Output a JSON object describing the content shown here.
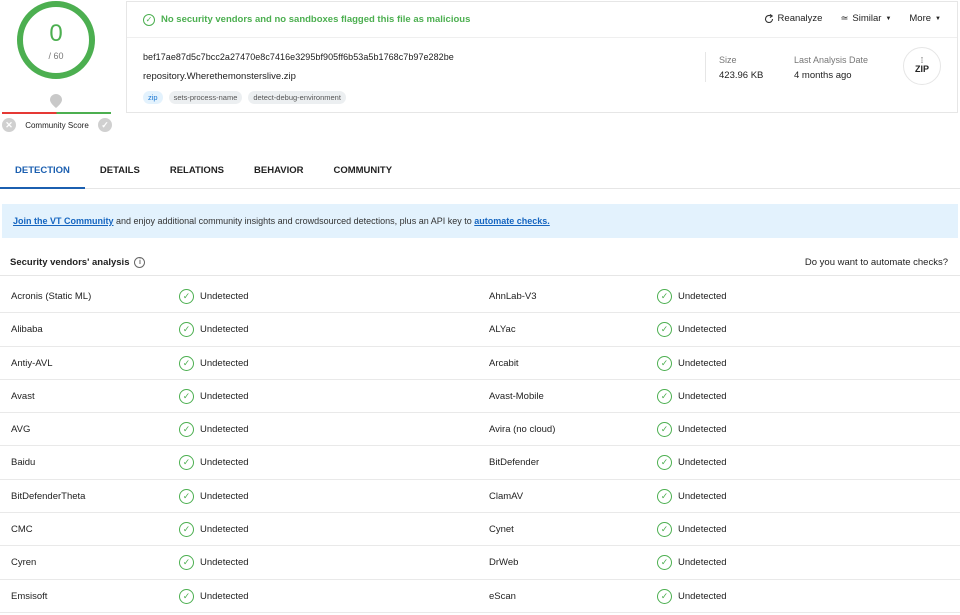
{
  "score": {
    "value": "0",
    "total": "/ 60",
    "community_label": "Community Score"
  },
  "summary": {
    "status": "No security vendors and no sandboxes flagged this file as malicious",
    "actions": {
      "reanalyze": "Reanalyze",
      "similar": "Similar",
      "more": "More"
    },
    "hash": "bef17ae87d5c7bcc2a27470e8c7416e3295bf905ff6b53a5b1768c7b97e282be",
    "filename": "repository.Wherethemonsterslive.zip",
    "tags": [
      "zip",
      "sets-process-name",
      "detect-debug-environment"
    ],
    "size_label": "Size",
    "size_value": "423.96 KB",
    "last_analysis_label": "Last Analysis Date",
    "last_analysis_value": "4 months ago",
    "file_type": "ZIP"
  },
  "tabs": [
    "DETECTION",
    "DETAILS",
    "RELATIONS",
    "BEHAVIOR",
    "COMMUNITY"
  ],
  "banner": {
    "link1": "Join the VT Community",
    "middle": " and enjoy additional community insights and crowdsourced detections, plus an API key to ",
    "link2": "automate checks."
  },
  "vendors": {
    "title": "Security vendors' analysis",
    "right_link": "Do you want to automate checks?",
    "rows": [
      {
        "left": "Acronis (Static ML)",
        "left_result": "Undetected",
        "right": "AhnLab-V3",
        "right_result": "Undetected"
      },
      {
        "left": "Alibaba",
        "left_result": "Undetected",
        "right": "ALYac",
        "right_result": "Undetected"
      },
      {
        "left": "Antiy-AVL",
        "left_result": "Undetected",
        "right": "Arcabit",
        "right_result": "Undetected"
      },
      {
        "left": "Avast",
        "left_result": "Undetected",
        "right": "Avast-Mobile",
        "right_result": "Undetected"
      },
      {
        "left": "AVG",
        "left_result": "Undetected",
        "right": "Avira (no cloud)",
        "right_result": "Undetected"
      },
      {
        "left": "Baidu",
        "left_result": "Undetected",
        "right": "BitDefender",
        "right_result": "Undetected"
      },
      {
        "left": "BitDefenderTheta",
        "left_result": "Undetected",
        "right": "ClamAV",
        "right_result": "Undetected"
      },
      {
        "left": "CMC",
        "left_result": "Undetected",
        "right": "Cynet",
        "right_result": "Undetected"
      },
      {
        "left": "Cyren",
        "left_result": "Undetected",
        "right": "DrWeb",
        "right_result": "Undetected"
      },
      {
        "left": "Emsisoft",
        "left_result": "Undetected",
        "right": "eScan",
        "right_result": "Undetected"
      }
    ]
  }
}
